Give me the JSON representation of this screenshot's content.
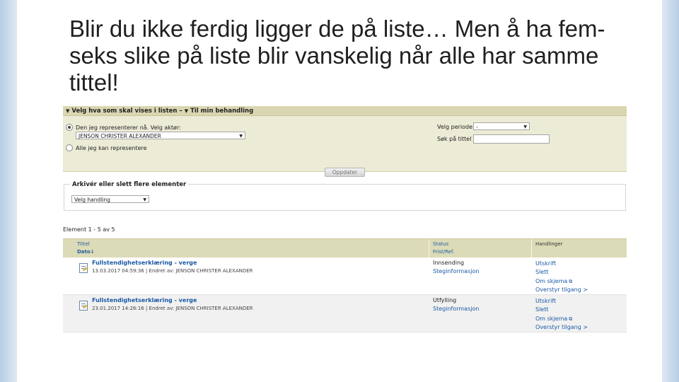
{
  "slide": {
    "title": "Blir du ikke ferdig ligger de på liste… Men å ha fem-seks slike på liste blir vanskelig når alle har samme tittel!"
  },
  "filter": {
    "header_left": "Velg hva som skal vises i listen –",
    "header_right": "Til min behandling",
    "radio_represent": "Den jeg representerer nå. Velg aktør:",
    "actor_value": "JENSON CHRISTER ALEXANDER",
    "radio_all": "Alle jeg kan representere",
    "period_label": "Velg periode",
    "period_value": "-",
    "search_label": "Søk på tittel",
    "update_button": "Oppdater"
  },
  "archive": {
    "legend": "Arkivér eller slett flere elementer",
    "action_select": "Velg handling"
  },
  "list": {
    "count_text": "Element 1 - 5 av 5",
    "headers": {
      "title": "Tittel",
      "date": "Dato↓",
      "status": "Status",
      "deadline": "Frist/Ref.",
      "actions": "Handlinger"
    },
    "rows": [
      {
        "title": "Fullstendighetserklæring - verge",
        "meta": "13.03.2017 04:59:36 | Endret av: JENSON CHRISTER ALEXANDER",
        "status": "Innsending",
        "info": "Steginformasjon",
        "actions": [
          "Utskrift",
          "Slett",
          "Om skjema",
          "Overstyr tilgang >"
        ]
      },
      {
        "title": "Fullstendighetserklæring - verge",
        "meta": "23.01.2017 14:26:16 | Endret av: JENSON CHRISTER ALEXANDER",
        "status": "Utfylling",
        "info": "Steginformasjon",
        "actions": [
          "Utskrift",
          "Slett",
          "Om skjema",
          "Overstyr tilgang >"
        ]
      }
    ]
  }
}
